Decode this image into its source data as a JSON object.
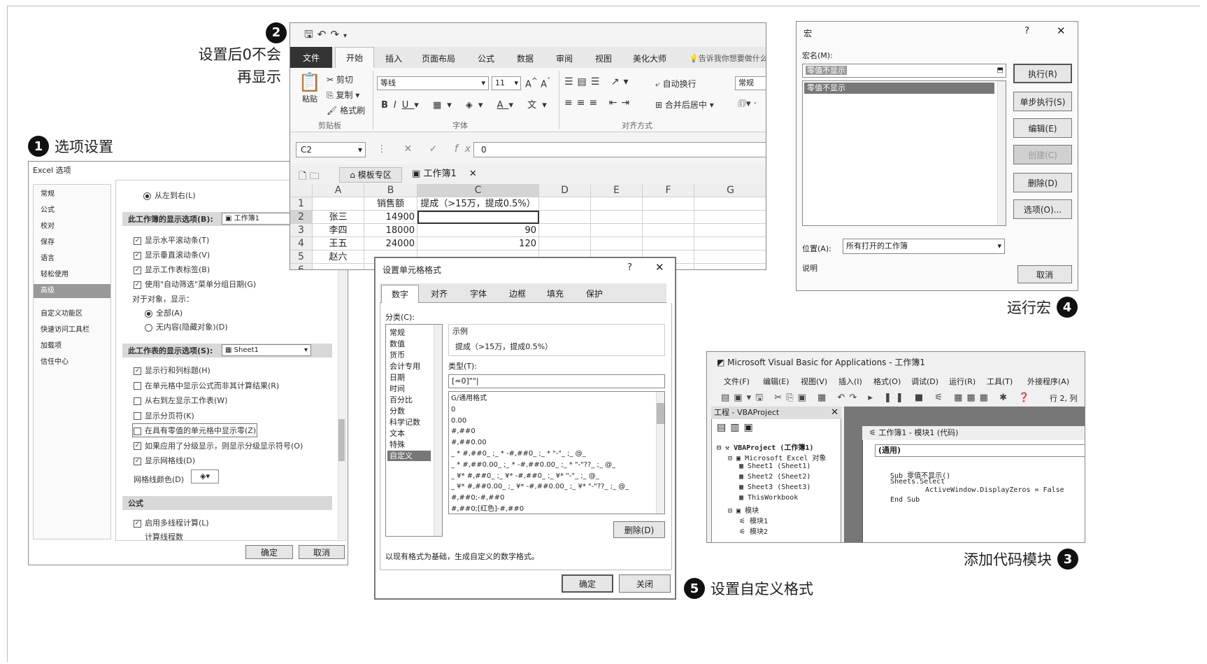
{
  "captions": {
    "c1_num": "1",
    "c1_text": "选项设置",
    "c2_num": "2",
    "c2_line1": "设置后0不会",
    "c2_line2": "再显示",
    "c3_num": "3",
    "c3_text": "添加代码模块",
    "c4_num": "4",
    "c4_text": "运行宏",
    "c5_num": "5",
    "c5_text": "设置自定义格式"
  },
  "excel_options": {
    "title": "Excel 选项",
    "nav": [
      "常规",
      "公式",
      "校对",
      "保存",
      "语言",
      "轻松使用",
      "高级",
      "自定义功能区",
      "快速访问工具栏",
      "加载项",
      "信任中心"
    ],
    "nav_selected": 6,
    "top_radio": "从左到右(L)",
    "workbook_section": "此工作簿的显示选项(B):",
    "workbook_value": "工作簿1",
    "workbook_opts": [
      "显示水平滚动条(T)",
      "显示垂直滚动条(V)",
      "显示工作表标签(B)",
      "使用\"自动筛选\"菜单分组日期(G)"
    ],
    "objects_label": "对于对象，显示：",
    "objects_opts": [
      "全部(A)",
      "无内容(隐藏对象)(D)"
    ],
    "sheet_section": "此工作表的显示选项(S):",
    "sheet_value": "Sheet1",
    "sheet_opts": [
      {
        "label": "显示行和列标题(H)",
        "checked": true
      },
      {
        "label": "在单元格中显示公式而非其计算结果(R)",
        "checked": false
      },
      {
        "label": "从右到左显示工作表(W)",
        "checked": false
      },
      {
        "label": "显示分页符(K)",
        "checked": false
      },
      {
        "label": "在具有零值的单元格中显示零(Z)",
        "checked": false
      },
      {
        "label": "如果应用了分级显示，则显示分级显示符号(O)",
        "checked": true
      },
      {
        "label": "显示网格线(D)",
        "checked": true
      }
    ],
    "gridcolor_label": "网格线颜色(D)",
    "formula_section": "公式",
    "formula_opt": "启用多线程计算(L)",
    "formula_sub": "计算线程数",
    "ok": "确定",
    "cancel": "取消"
  },
  "excel": {
    "qat": [
      "save",
      "undo",
      "redo"
    ],
    "tabs": [
      "文件",
      "开始",
      "插入",
      "页面布局",
      "公式",
      "数据",
      "审阅",
      "视图",
      "美化大师"
    ],
    "tell": "告诉我你想要做什么",
    "clipboard": {
      "paste": "粘贴",
      "cut": "剪切",
      "copy": "复制",
      "painter": "格式刷",
      "group": "剪贴板"
    },
    "font": {
      "name": "等线",
      "size": "11",
      "group": "字体"
    },
    "align": {
      "wrap": "自动换行",
      "merge": "合并后居中",
      "group": "对齐方式"
    },
    "number": {
      "format": "常规"
    },
    "namebox": "C2",
    "formula": "0",
    "wbtabs": {
      "templates": "模板专区",
      "book": "工作簿1"
    },
    "cols": [
      "A",
      "B",
      "C",
      "D",
      "E",
      "F",
      "G"
    ],
    "rows": [
      {
        "n": "1",
        "a": "",
        "b": "销售额",
        "c": "提成（>15万，提成0.5%）"
      },
      {
        "n": "2",
        "a": "张三",
        "b": "14900",
        "c": ""
      },
      {
        "n": "3",
        "a": "李四",
        "b": "18000",
        "c": "90"
      },
      {
        "n": "4",
        "a": "王五",
        "b": "24000",
        "c": "120"
      },
      {
        "n": "5",
        "a": "赵六",
        "b": "",
        "c": ""
      },
      {
        "n": "6",
        "a": "",
        "b": "",
        "c": ""
      }
    ]
  },
  "format_dialog": {
    "title": "设置单元格格式",
    "tabs": [
      "数字",
      "对齐",
      "字体",
      "边框",
      "填充",
      "保护"
    ],
    "category_label": "分类(C):",
    "categories": [
      "常规",
      "数值",
      "货币",
      "会计专用",
      "日期",
      "时间",
      "百分比",
      "分数",
      "科学记数",
      "文本",
      "特殊",
      "自定义"
    ],
    "category_selected": 11,
    "sample_label": "示例",
    "sample": "提成（>15万，提成0.5%）",
    "type_label": "类型(T):",
    "type_value": "[=0]\"\"",
    "type_list": [
      "G/通用格式",
      "0",
      "0.00",
      "#,##0",
      "#,##0.00",
      "_ * #,##0_ ;_ * -#,##0_ ;_ * \"-\"_ ;_ @_",
      "_ * #,##0.00_ ;_ * -#,##0.00_ ;_ * \"-\"??_ ;_ @_",
      "_ ¥* #,##0_ ;_ ¥* -#,##0_ ;_ ¥* \"-\"_ ;_ @_",
      "_ ¥* #,##0.00_ ;_ ¥* -#,##0.00_ ;_ ¥* \"-\"??_ ;_ @_",
      "#,##0;-#,##0",
      "#,##0;[红色]-#,##0"
    ],
    "delete": "删除(D)",
    "hint": "以现有格式为基础，生成自定义的数字格式。",
    "ok": "确定",
    "close": "关闭"
  },
  "macro_dialog": {
    "title": "宏",
    "help": "?",
    "name_label": "宏名(M):",
    "name_value": "零值不显示",
    "list": [
      "零值不显示"
    ],
    "buttons": [
      "执行(R)",
      "单步执行(S)",
      "编辑(E)",
      "创建(C)",
      "删除(D)",
      "选项(O)..."
    ],
    "location_label": "位置(A):",
    "location_value": "所有打开的工作簿",
    "desc_label": "说明",
    "cancel": "取消"
  },
  "vba": {
    "title": "Microsoft Visual Basic for Applications - 工作簿1",
    "menu": [
      "文件(F)",
      "编辑(E)",
      "视图(V)",
      "插入(I)",
      "格式(O)",
      "调试(D)",
      "运行(R)",
      "工具(T)",
      "外接程序(A)"
    ],
    "pos": "行 2, 列",
    "project_title": "工程 - VBAProject",
    "tree": [
      "VBAProject (工作簿1)",
      "Microsoft Excel 对象",
      "Sheet1 (Sheet1)",
      "Sheet2 (Sheet2)",
      "Sheet3 (Sheet3)",
      "ThisWorkbook",
      "模块",
      "模块1",
      "模块2"
    ],
    "code_title": "工作簿1 - 模块1 (代码)",
    "general": "(通用)",
    "code": [
      "Sub 零值不显示()",
      "Sheets.Select",
      "ActiveWindow.DisplayZeros = False",
      "End Sub"
    ]
  }
}
